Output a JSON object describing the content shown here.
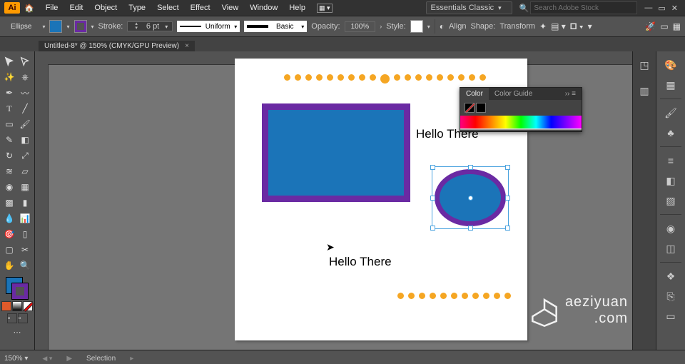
{
  "app_badge": "Ai",
  "menu": [
    "File",
    "Edit",
    "Object",
    "Type",
    "Select",
    "Effect",
    "View",
    "Window",
    "Help"
  ],
  "workspace": "Essentials Classic",
  "search_placeholder": "Search Adobe Stock",
  "control": {
    "tool": "Ellipse",
    "stroke_label": "Stroke:",
    "stroke_pt": "6 pt",
    "stroke_profile": "Uniform",
    "brush_def": "Basic",
    "opacity_label": "Opacity:",
    "opacity_val": "100%",
    "style_label": "Style:",
    "align": "Align",
    "shape": "Shape:",
    "transform": "Transform"
  },
  "tab": "Untitled-8* @ 150% (CMYK/GPU Preview)",
  "colorpanel": {
    "t1": "Color",
    "t2": "Color Guide"
  },
  "artboard": {
    "text1": "Hello There",
    "text2": "Hello There"
  },
  "status": {
    "zoom": "150%",
    "tool": "Selection"
  },
  "watermark": "aeziyuan",
  "watermark2": ".com",
  "colors": {
    "fill": "#1b74b8",
    "stroke": "#6a2aa3",
    "orange": "#f5a623"
  }
}
